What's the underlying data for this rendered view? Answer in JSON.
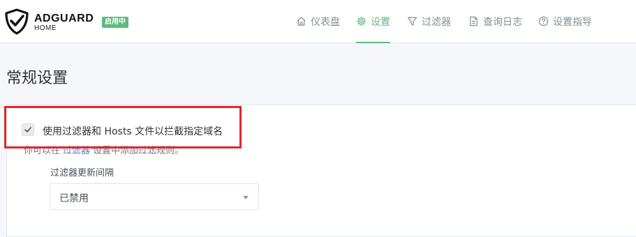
{
  "header": {
    "brand_name": "ADGUARD",
    "brand_sub": "HOME",
    "status_badge": "启用中",
    "nav": [
      {
        "label": "仪表盘",
        "icon": "home-icon",
        "active": false
      },
      {
        "label": "设置",
        "icon": "gear-icon",
        "active": true
      },
      {
        "label": "过滤器",
        "icon": "filter-icon",
        "active": false
      },
      {
        "label": "查询日志",
        "icon": "document-icon",
        "active": false
      },
      {
        "label": "设置指导",
        "icon": "help-circle-icon",
        "active": false
      }
    ]
  },
  "page": {
    "title": "常规设置"
  },
  "general": {
    "filter_checkbox_label": "使用过滤器和 Hosts 文件以拦截指定域名",
    "filter_checkbox_checked": true,
    "hint_prefix": "你可以在",
    "hint_link": "过滤器",
    "hint_suffix": "设置中添加过滤规则。",
    "interval_label": "过滤器更新间隔",
    "interval_value": "已禁用"
  },
  "colors": {
    "accent": "#5eba7d",
    "link": "#467fcf",
    "highlight": "#e3252b"
  }
}
